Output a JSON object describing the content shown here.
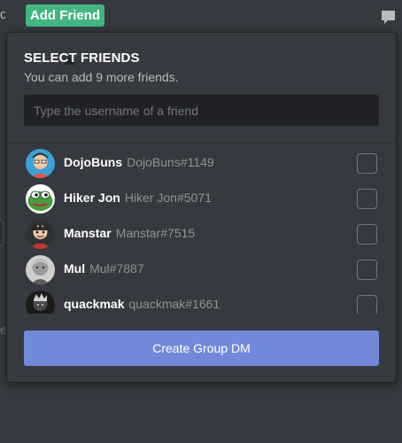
{
  "topbar": {
    "edge_text": "d",
    "add_friend_label": "Add Friend",
    "inbox_icon": "inbox-icon"
  },
  "left_edge": {
    "letter": "e"
  },
  "modal": {
    "title": "SELECT FRIENDS",
    "subtitle": "You can add 9 more friends.",
    "search_placeholder": "Type the username of a friend",
    "create_button_label": "Create Group DM"
  },
  "friends": [
    {
      "name": "DojoBuns",
      "tag": "DojoBuns#1149",
      "avatar": "cartoon-boy-avatar"
    },
    {
      "name": "Hiker Jon",
      "tag": "Hiker Jon#5071",
      "avatar": "green-frog-avatar"
    },
    {
      "name": "Manstar",
      "tag": "Manstar#7515",
      "avatar": "cartoon-character-avatar"
    },
    {
      "name": "Mul",
      "tag": "Mul#7887",
      "avatar": "grayscale-photo-avatar"
    },
    {
      "name": "quackmak",
      "tag": "quackmak#1661",
      "avatar": "dark-photo-avatar"
    }
  ],
  "colors": {
    "background": "#36393f",
    "add_friend_green": "#43b581",
    "create_button_blurple": "#7289da",
    "input_background": "#202225"
  }
}
